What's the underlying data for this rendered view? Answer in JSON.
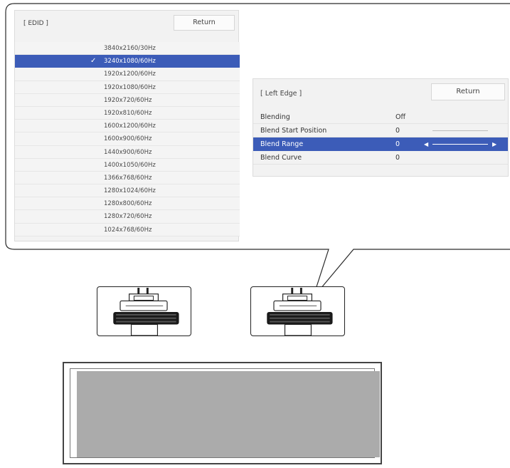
{
  "edid_panel": {
    "title": "[ EDID ]",
    "return_label": "Return",
    "check_mark": "✓",
    "items": [
      {
        "label": "3840x2160/30Hz",
        "selected": false
      },
      {
        "label": "3240x1080/60Hz",
        "selected": true
      },
      {
        "label": "1920x1200/60Hz",
        "selected": false
      },
      {
        "label": "1920x1080/60Hz",
        "selected": false
      },
      {
        "label": "1920x720/60Hz",
        "selected": false
      },
      {
        "label": "1920x810/60Hz",
        "selected": false
      },
      {
        "label": "1600x1200/60Hz",
        "selected": false
      },
      {
        "label": "1600x900/60Hz",
        "selected": false
      },
      {
        "label": "1440x900/60Hz",
        "selected": false
      },
      {
        "label": "1400x1050/60Hz",
        "selected": false
      },
      {
        "label": "1366x768/60Hz",
        "selected": false
      },
      {
        "label": "1280x1024/60Hz",
        "selected": false
      },
      {
        "label": "1280x800/60Hz",
        "selected": false
      },
      {
        "label": "1280x720/60Hz",
        "selected": false
      },
      {
        "label": "1024x768/60Hz",
        "selected": false
      }
    ]
  },
  "left_edge_panel": {
    "title": "[ Left Edge ]",
    "return_label": "Return",
    "rows": [
      {
        "label": "Blending",
        "value": "Off",
        "selected": false,
        "slider": false
      },
      {
        "label": "Blend Start Position",
        "value": "0",
        "selected": false,
        "slider": true
      },
      {
        "label": "Blend Range",
        "value": "0",
        "selected": true,
        "slider": true
      },
      {
        "label": "Blend Curve",
        "value": "0",
        "selected": false,
        "slider": false
      }
    ]
  },
  "colors": {
    "selection": "#3c5cb8",
    "panel_bg": "#f2f2f2",
    "screen_fill": "#ababab"
  }
}
